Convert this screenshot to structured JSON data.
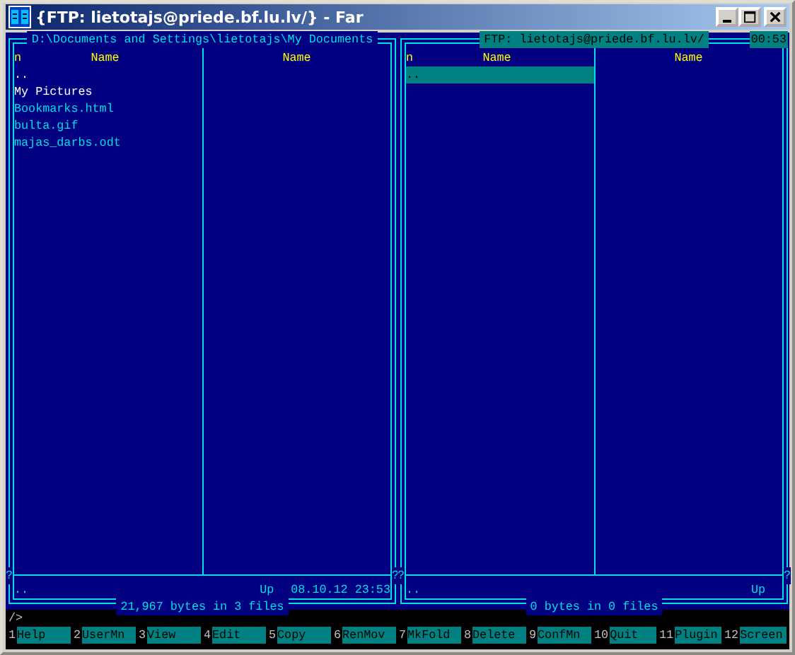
{
  "window": {
    "title": "{FTP: lietotajs@priede.bf.lu.lv/} - Far"
  },
  "panels": [
    {
      "title": "D:\\Documents and Settings\\lietotajs\\My Documents",
      "title_selected": false,
      "sort_mark": "n",
      "columns": [
        "Name",
        "Name"
      ],
      "items": [
        {
          "name": "..",
          "kind": "up",
          "selected": false
        },
        {
          "name": "My Pictures",
          "kind": "folder",
          "selected": false
        },
        {
          "name": "Bookmarks.html",
          "kind": "file",
          "selected": false
        },
        {
          "name": "bulta.gif",
          "kind": "file",
          "selected": false
        },
        {
          "name": "majas_darbs.odt",
          "kind": "file",
          "selected": false
        }
      ],
      "separator_marks": [
        "?",
        "?"
      ],
      "info": {
        "name": "..",
        "type": "Up",
        "date": "08.10.12 23:53"
      },
      "summary": "21,967 bytes in 3 files"
    },
    {
      "title": "FTP: lietotajs@priede.bf.lu.lv/",
      "title_selected": true,
      "clock": "00:53",
      "sort_mark": "n",
      "columns": [
        "Name",
        "Name"
      ],
      "items": [
        {
          "name": "..",
          "kind": "up",
          "selected": true
        }
      ],
      "separator_marks": [
        "?",
        "?"
      ],
      "info": {
        "name": "..",
        "type": "Up"
      },
      "summary": "0 bytes in 0 files"
    }
  ],
  "command_line": {
    "prompt": "/>"
  },
  "keybar": [
    {
      "number": "1",
      "label": "Help"
    },
    {
      "number": "2",
      "label": "UserMn"
    },
    {
      "number": "3",
      "label": "View"
    },
    {
      "number": "4",
      "label": "Edit"
    },
    {
      "number": "5",
      "label": "Copy"
    },
    {
      "number": "6",
      "label": "RenMov"
    },
    {
      "number": "7",
      "label": "MkFold"
    },
    {
      "number": "8",
      "label": "Delete"
    },
    {
      "number": "9",
      "label": "ConfMn"
    },
    {
      "number": "10",
      "label": "Quit"
    },
    {
      "number": "11",
      "label": "Plugin"
    },
    {
      "number": "12",
      "label": "Screen"
    }
  ]
}
